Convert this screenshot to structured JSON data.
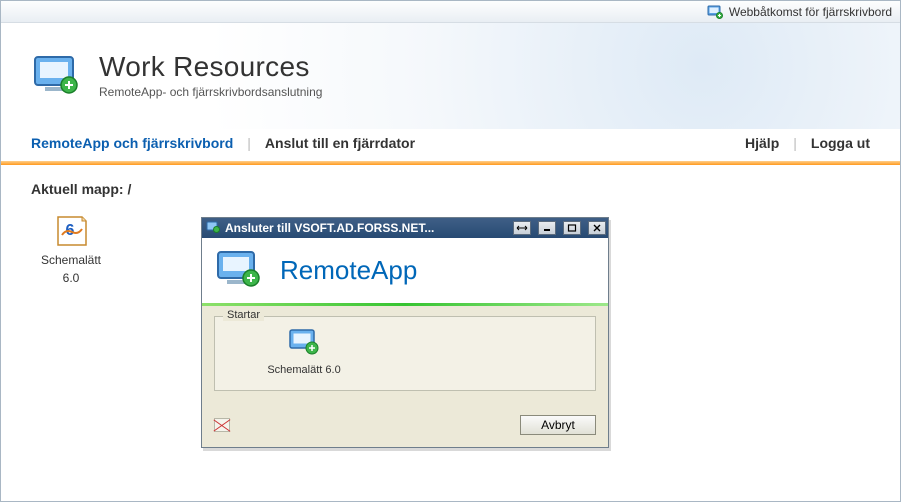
{
  "topbar": {
    "link_label": "Webbåtkomst för fjärrskrivbord"
  },
  "header": {
    "title": "Work Resources",
    "subtitle": "RemoteApp- och fjärrskrivbordsanslutning"
  },
  "nav": {
    "tab_active": "RemoteApp och fjärrskrivbord",
    "tab_connect": "Anslut till en fjärrdator",
    "help": "Hjälp",
    "logout": "Logga ut"
  },
  "content": {
    "current_folder_label": "Aktuell mapp: /",
    "apps": [
      {
        "label_line1": "Schemalätt",
        "label_line2": "6.0"
      }
    ]
  },
  "dialog": {
    "title": "Ansluter till VSOFT.AD.FORSS.NET...",
    "brand": "RemoteApp",
    "group_legend": "Startar",
    "starting_app_label": "Schemalätt 6.0",
    "cancel_label": "Avbryt"
  }
}
